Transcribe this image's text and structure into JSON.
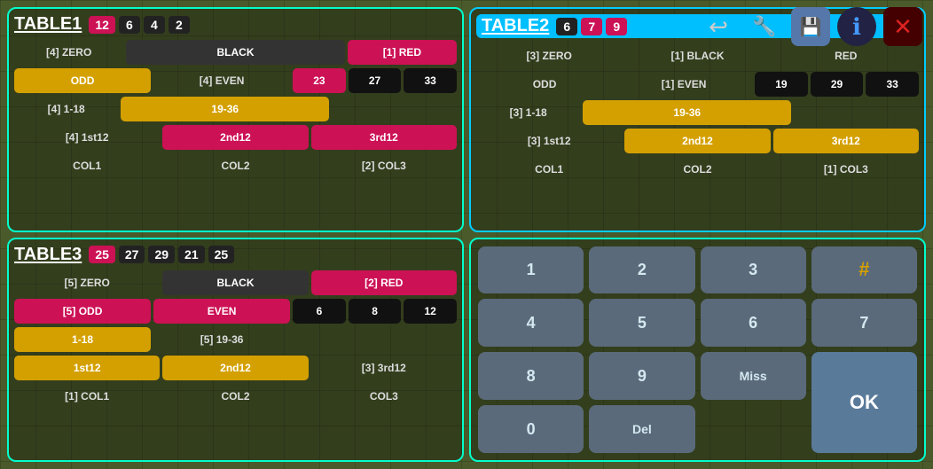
{
  "topbar": {
    "back_icon": "↩",
    "wrench_icon": "🔧",
    "save_icon": "💾",
    "info_icon": "ℹ",
    "close_icon": "✕"
  },
  "table1": {
    "title": "TABLE1",
    "badges": [
      {
        "value": "12",
        "color": "pink"
      },
      {
        "value": "6",
        "color": "black"
      },
      {
        "value": "4",
        "color": "black"
      },
      {
        "value": "2",
        "color": "black"
      }
    ],
    "rows": {
      "row1": [
        "[4] ZERO",
        "BLACK",
        "[1] RED"
      ],
      "row2_left": "ODD",
      "row2_mid": "[4] EVEN",
      "row2_nums": [
        "23",
        "27",
        "33"
      ],
      "row3_left": "[4] 1-18",
      "row3_mid": "19-36",
      "row4_left": "[4] 1st12",
      "row4_mid": "2nd12",
      "row4_right": "3rd12",
      "row5": [
        "COL1",
        "COL2",
        "[2] COL3"
      ]
    }
  },
  "table2": {
    "title": "TABLE2",
    "badges": [
      {
        "value": "6",
        "color": "black"
      },
      {
        "value": "7",
        "color": "pink"
      },
      {
        "value": "9",
        "color": "pink"
      }
    ],
    "header_color": "cyan",
    "rows": {
      "row1": [
        "[3] ZERO",
        "[1] BLACK",
        "RED"
      ],
      "row2_left": "ODD",
      "row2_mid": "[1] EVEN",
      "row2_nums": [
        "19",
        "29",
        "33"
      ],
      "row3_left": "[3] 1-18",
      "row3_mid": "19-36",
      "row4_left": "[3] 1st12",
      "row4_mid": "2nd12",
      "row4_right": "3rd12",
      "row5": [
        "COL1",
        "COL2",
        "[1] COL3"
      ]
    }
  },
  "table3": {
    "title": "TABLE3",
    "badges": [
      {
        "value": "25",
        "color": "pink"
      },
      {
        "value": "27",
        "color": "black"
      },
      {
        "value": "29",
        "color": "black"
      },
      {
        "value": "21",
        "color": "black"
      },
      {
        "value": "25",
        "color": "black"
      }
    ],
    "rows": {
      "row1": [
        "[5] ZERO",
        "BLACK",
        "[2] RED"
      ],
      "row2_left": "[5] ODD",
      "row2_mid": "EVEN",
      "row2_nums": [
        "6",
        "8",
        "12"
      ],
      "row3_left": "1-18",
      "row3_mid": "[5] 19-36",
      "row4_left": "1st12",
      "row4_mid": "2nd12",
      "row4_right": "[3] 3rd12",
      "row5": [
        "[1] COL1",
        "COL2",
        "COL3"
      ]
    }
  },
  "numpad": {
    "buttons": [
      "1",
      "2",
      "3",
      "4",
      "5",
      "6",
      "7",
      "8",
      "9",
      "Miss",
      "0",
      "Del"
    ],
    "hash": "#",
    "ok": "OK"
  }
}
